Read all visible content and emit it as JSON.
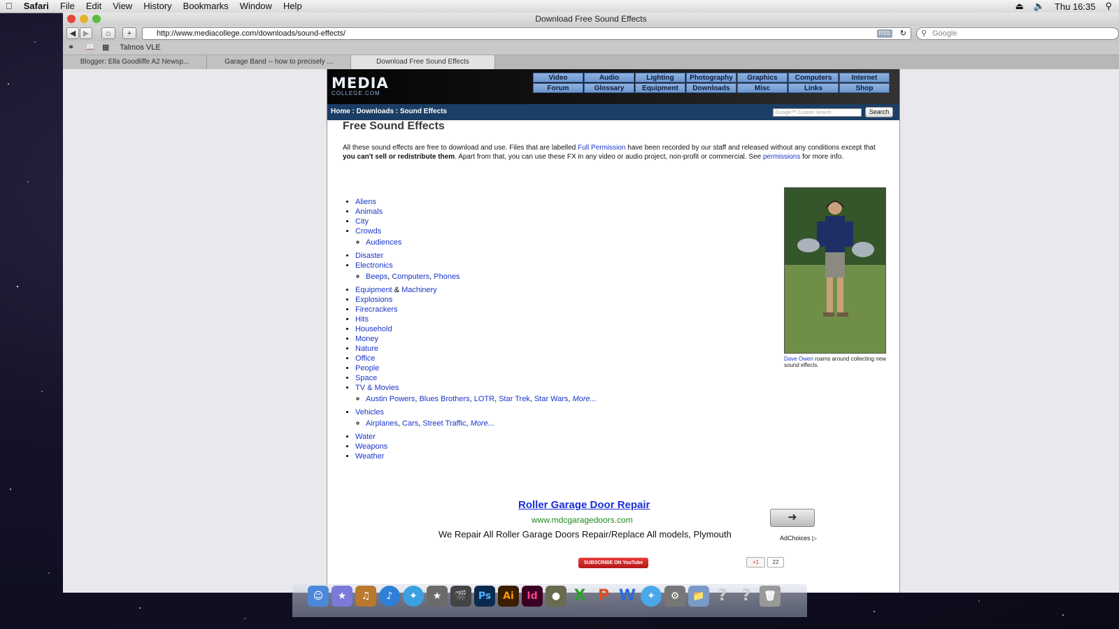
{
  "menubar": {
    "app": "Safari",
    "items": [
      "File",
      "Edit",
      "View",
      "History",
      "Bookmarks",
      "Window",
      "Help"
    ],
    "clock": "Thu 16:35"
  },
  "window": {
    "title": "Download Free Sound Effects",
    "url": "http://www.mediacollege.com/downloads/sound-effects/",
    "rss_label": "RSS",
    "search_placeholder": "Google",
    "bookmark": "Talmos VLE",
    "tabs": [
      "Blogger: Ella Goodliffe A2 Newsp...",
      "Garage Band -- how to precisely ...",
      "Download Free Sound Effects"
    ]
  },
  "site": {
    "logo_main": "MEDIA",
    "logo_sub": "COLLEGE.COM",
    "nav": [
      "Video",
      "Audio",
      "Lighting",
      "Photography",
      "Graphics",
      "Computers",
      "Internet",
      "Forum",
      "Glossary",
      "Equipment",
      "Downloads",
      "Misc",
      "Links",
      "Shop"
    ],
    "breadcrumb": "Home : Downloads : Sound Effects",
    "cse_placeholder": "Google™ Custom Search",
    "search_btn": "Search"
  },
  "main": {
    "title": "Free Sound Effects",
    "intro_1": "All these sound effects are free to download and use. Files that are labelled ",
    "intro_link1": "Full Permission",
    "intro_2": " have been recorded by our staff and released without any conditions except that ",
    "intro_bold": "you can't sell or redistribute them",
    "intro_3": ". Apart from that, you can use these FX in any video or audio project, non-profit or commercial. See ",
    "intro_link2": "permissions",
    "intro_4": " for more info.",
    "cats": {
      "aliens": "Aliens",
      "animals": "Animals",
      "city": "City",
      "crowds": "Crowds",
      "audiences": "Audiences",
      "disaster": "Disaster",
      "electronics": "Electronics",
      "beeps": "Beeps",
      "computers": "Computers",
      "phones": "Phones",
      "equipment": "Equipment",
      "amp": "&",
      "machinery": "Machinery",
      "explosions": "Explosions",
      "firecrackers": "Firecrackers",
      "hits": "Hits",
      "household": "Household",
      "money": "Money",
      "nature": "Nature",
      "office": "Office",
      "people": "People",
      "space": "Space",
      "tv": "TV & Movies",
      "austin": "Austin Powers",
      "blues": "Blues Brothers",
      "lotr": "LOTR",
      "startrek": "Star Trek",
      "starwars": "Star Wars",
      "more": "More...",
      "vehicles": "Vehicles",
      "airplanes": "Airplanes",
      "cars": "Cars",
      "traffic": "Street Traffic",
      "water": "Water",
      "weapons": "Weapons",
      "weather": "Weather"
    },
    "caption_link": "Dave Owen",
    "caption_text": " roams around collecting new sound effects."
  },
  "ad": {
    "title": "Roller Garage Door Repair",
    "url": "www.mdcgaragedoors.com",
    "text": "We Repair All Roller Garage Doors Repair/Replace All models, Plymouth",
    "choices": "AdChoices",
    "youtube": "SUBSCRIBE ON YouTube",
    "gplus": "+1",
    "gcount": "22"
  },
  "dock": [
    "Finder",
    "Comic Life",
    "GarageBand",
    "iTunes",
    "Safari",
    "iMovie",
    "Final Cut",
    "Ps",
    "Ai",
    "Id",
    "iPhoto",
    "Excel",
    "PowerPoint",
    "Word",
    "Safari",
    "System Preferences",
    "Applications",
    "?",
    "?",
    "Trash"
  ]
}
